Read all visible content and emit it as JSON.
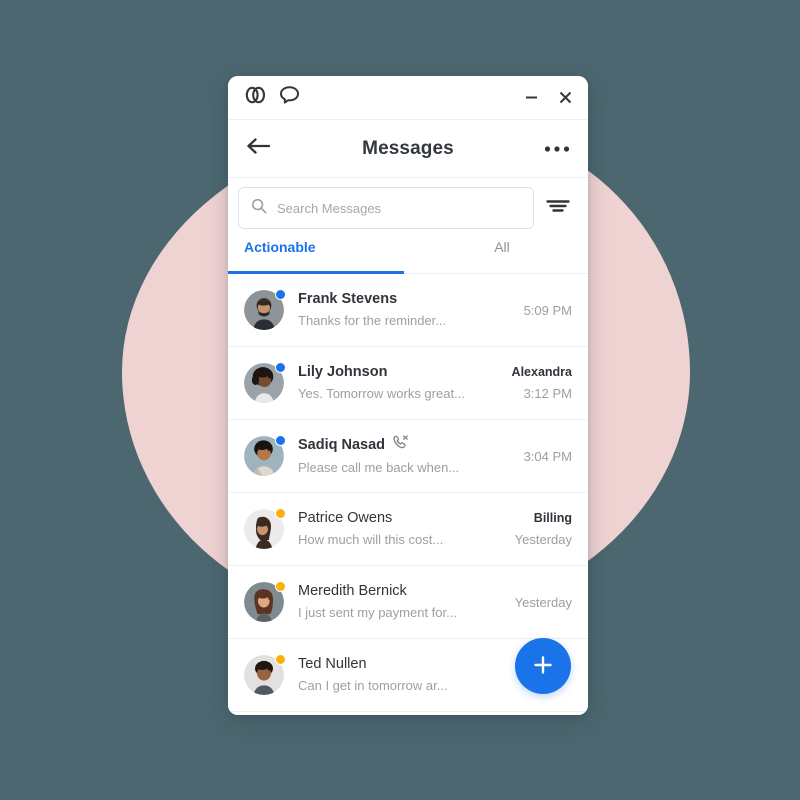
{
  "theme": {
    "background_color": "#4c6770",
    "blob_color": "#efd2d2",
    "accent_color": "#1a73e8",
    "unread_badge_color": "#1a73e8",
    "pending_badge_color": "#fab005",
    "window_background": "#ffffff"
  },
  "titlebar": {
    "logo_icon": "infinity-loops-icon",
    "chat_icon": "speech-bubble-icon",
    "minimize_label": "–",
    "minimize_icon": "minimize-icon",
    "close_label": "×",
    "close_icon": "close-icon"
  },
  "header": {
    "back_icon": "arrow-left-icon",
    "title": "Messages",
    "more_icon": "more-horizontal-icon"
  },
  "search": {
    "icon": "search-icon",
    "placeholder": "Search Messages",
    "value": "",
    "filter_icon": "filter-icon"
  },
  "tabs": [
    {
      "label": "Actionable",
      "active": true
    },
    {
      "label": "All",
      "active": false
    }
  ],
  "messages": [
    {
      "name": "Frank Stevens",
      "preview": "Thanks for the reminder...",
      "label": "",
      "time": "5:09 PM",
      "unread": true,
      "badge": "blue",
      "status_icon": "",
      "avatar": "frank-stevens-avatar"
    },
    {
      "name": "Lily Johnson",
      "preview": "Yes. Tomorrow works great...",
      "label": "Alexandra",
      "time": "3:12 PM",
      "unread": true,
      "badge": "blue",
      "status_icon": "",
      "avatar": "lily-johnson-avatar"
    },
    {
      "name": "Sadiq Nasad",
      "preview": "Please call me back when...",
      "label": "",
      "time": "3:04 PM",
      "unread": true,
      "badge": "blue",
      "status_icon": "missed-call-icon",
      "avatar": "sadiq-nasad-avatar"
    },
    {
      "name": "Patrice Owens",
      "preview": "How much will this cost...",
      "label": "Billing",
      "time": "Yesterday",
      "unread": false,
      "badge": "amber",
      "status_icon": "",
      "avatar": "patrice-owens-avatar"
    },
    {
      "name": "Meredith Bernick",
      "preview": "I just sent my payment for...",
      "label": "",
      "time": "Yesterday",
      "unread": false,
      "badge": "amber",
      "status_icon": "",
      "avatar": "meredith-bernick-avatar"
    },
    {
      "name": "Ted Nullen",
      "preview": "Can I get in tomorrow ar...",
      "label": "",
      "time": "",
      "unread": false,
      "badge": "amber",
      "status_icon": "",
      "avatar": "ted-nullen-avatar"
    }
  ],
  "fab": {
    "icon": "plus-icon",
    "label": "+"
  }
}
